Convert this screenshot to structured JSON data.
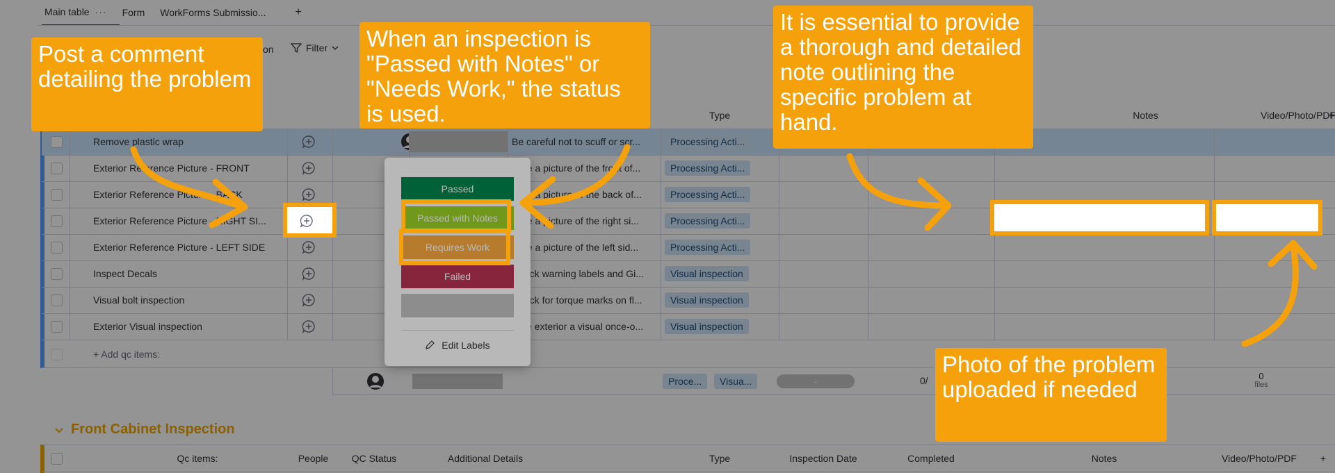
{
  "tabs": [
    {
      "label": "Main table",
      "more": "···"
    },
    {
      "label": "Form"
    },
    {
      "label": "WorkForms Submissio..."
    }
  ],
  "add_tab": "+",
  "toolbar": {
    "fragment": "on",
    "filter_label": "Filter"
  },
  "columns": {
    "type": "Type",
    "notes": "Notes",
    "video": "Video/Photo/PDF",
    "add": "+"
  },
  "rows": [
    {
      "name": "Remove plastic wrap",
      "details": "Be careful not to scuff or scr...",
      "type": "Processing Acti..."
    },
    {
      "name": "Exterior Reference Picture - FRONT",
      "details": "Take a picture of the front of...",
      "type": "Processing Acti..."
    },
    {
      "name": "Exterior Reference Picture - BACK",
      "details": "Take a picture of the back of...",
      "type": "Processing Acti..."
    },
    {
      "name": "Exterior Reference Picture - RIGHT SI...",
      "details": "Take a picture of the right si...",
      "type": "Processing Acti..."
    },
    {
      "name": "Exterior Reference Picture - LEFT SIDE",
      "details": "Take a picture of the left sid...",
      "type": "Processing Acti..."
    },
    {
      "name": "Inspect Decals",
      "details": "Check warning labels and Gi...",
      "type": "Visual inspection"
    },
    {
      "name": "Visual bolt inspection",
      "details": "Check for torque marks on fl...",
      "type": "Visual inspection"
    },
    {
      "name": "Exterior Visual inspection",
      "details": "Give exterior a visual once-o...",
      "type": "Visual inspection"
    }
  ],
  "add_item": "+ Add qc items:",
  "summary": {
    "type_a": "Proce...",
    "type_b": "Visua...",
    "date_dash": "-",
    "completed": "0/",
    "files_count": "0",
    "files_label": "files"
  },
  "dropdown": {
    "options": [
      {
        "label": "Passed",
        "color": "#00854d"
      },
      {
        "label": "Passed with Notes",
        "color": "#9cd326"
      },
      {
        "label": "Requires Work",
        "color": "#fdab3d"
      },
      {
        "label": "Failed",
        "color": "#bb3354"
      },
      {
        "label": "",
        "color": "#c4c4c4"
      }
    ],
    "edit_labels": "Edit Labels"
  },
  "group2": {
    "title": "Front Cabinet Inspection",
    "color": "#f0a500",
    "columns": [
      "Qc items:",
      "People",
      "QC Status",
      "Additional Details",
      "Type",
      "Inspection Date",
      "Completed",
      "Notes",
      "Video/Photo/PDF",
      "+"
    ]
  },
  "callouts": {
    "comment": "Post a comment detailing the problem",
    "status": "When an inspection is \"Passed with Notes\" or \"Needs Work,\" the status is used.",
    "notes": "It is essential to provide a thorough and detailed note outlining the specific problem at hand.",
    "photo": "Photo of the problem uploaded if needed"
  },
  "colors": {
    "accent": "#f5a10c",
    "group_blue": "#579bfc",
    "group_orange": "#f0a500"
  }
}
